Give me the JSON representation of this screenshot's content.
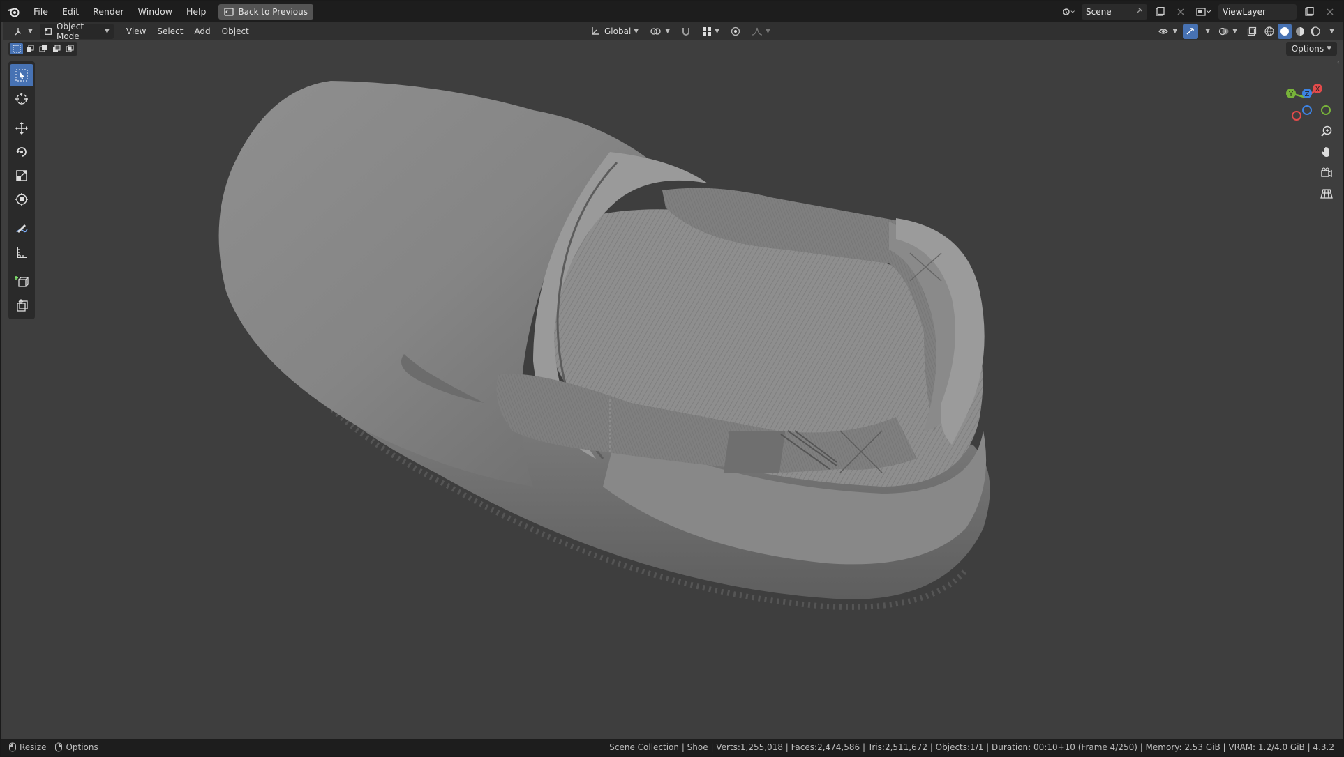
{
  "topbar": {
    "menus": [
      "File",
      "Edit",
      "Render",
      "Window",
      "Help"
    ],
    "back_label": "Back to Previous",
    "scene_name": "Scene",
    "viewlayer_name": "ViewLayer"
  },
  "header": {
    "mode_label": "Object Mode",
    "menus": [
      "View",
      "Select",
      "Add",
      "Object"
    ],
    "orientation_label": "Global"
  },
  "viewport": {
    "options_label": "Options",
    "gizmo_axes": [
      "X",
      "Y",
      "Z"
    ],
    "tools": [
      "select-box",
      "cursor",
      "move",
      "rotate",
      "scale",
      "transform",
      "annotate",
      "measure",
      "add-cube",
      "extrude"
    ]
  },
  "status": {
    "left_items": [
      "Resize",
      "Options"
    ],
    "info": "Scene Collection | Shoe | Verts:1,255,018 | Faces:2,474,586 | Tris:2,511,672 | Objects:1/1 | Duration: 00:10+10 (Frame 4/250) | Memory: 2.53 GiB | VRAM: 1.2/4.0 GiB | 4.3.2"
  },
  "colors": {
    "accent": "#4772b3",
    "axis_x": "#e34b4b",
    "axis_y": "#78b33a",
    "axis_z": "#3d83e3"
  }
}
